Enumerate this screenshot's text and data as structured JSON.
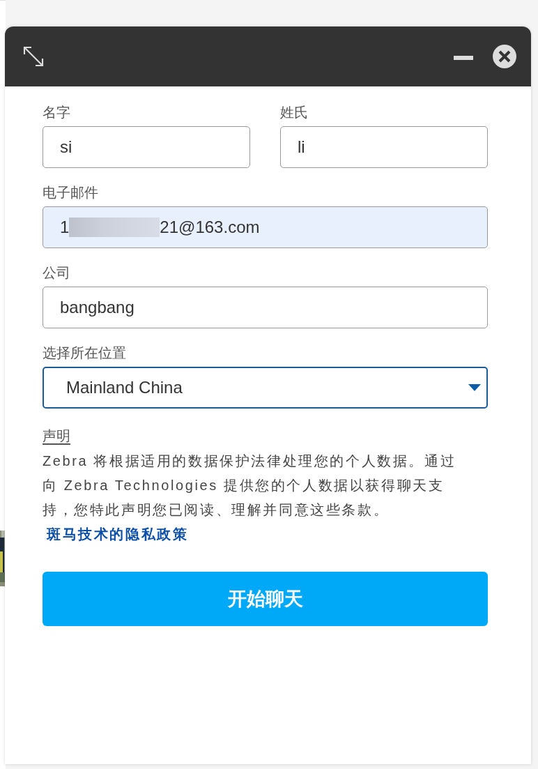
{
  "name_row": [
    {
      "label": "名字",
      "value": "si"
    },
    {
      "label": "姓氏",
      "value": "li"
    }
  ],
  "fields": [
    {
      "kind": "email",
      "label": "电子邮件",
      "value_start": "1",
      "redacted": true,
      "value_end": "21@163.com",
      "autofilled": true
    },
    {
      "kind": "text",
      "label": "公司",
      "value": "bangbang"
    },
    {
      "kind": "select",
      "label": "选择所在位置",
      "value": "Mainland China",
      "focused": true
    }
  ],
  "statement": {
    "heading": "声明",
    "text": "Zebra 将根据适用的数据保护法律处理您的个人数据。通过向 Zebra Technologies 提供您的个人数据以获得聊天支持，您特此声明您已阅读、理解并同意这些条款。",
    "link": "斑马技术的隐私政策"
  },
  "start_button": "开始聊天"
}
